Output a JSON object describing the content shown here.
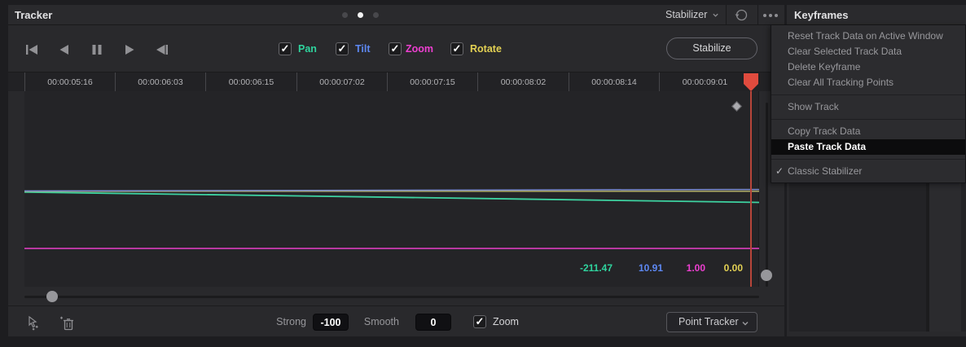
{
  "header": {
    "tracker_title": "Tracker",
    "keyframes_title": "Keyframes",
    "stabilizer_label": "Stabilizer",
    "pager": {
      "dots": 3,
      "active_index": 1
    }
  },
  "icons": {
    "skip_start": "skip-to-start",
    "step_back": "step-back",
    "pause": "pause",
    "play": "play",
    "skip_end": "skip-to-end",
    "reset_history": "circular-reset-arrow",
    "overflow": "ellipsis-menu",
    "stabilizer_chevron": "chevron-down",
    "add_tracker_point": "cursor-with-points",
    "delete_tracker_point": "trash-with-plus"
  },
  "toolbar": {
    "stabilize_button": "Stabilize",
    "checkboxes": [
      {
        "label": "Pan",
        "color": "#2fd49e",
        "checked": true
      },
      {
        "label": "Tilt",
        "color": "#5d88f2",
        "checked": true
      },
      {
        "label": "Zoom",
        "color": "#ee3fd1",
        "checked": true
      },
      {
        "label": "Rotate",
        "color": "#e2d053",
        "checked": true
      }
    ]
  },
  "context_menu": {
    "items": [
      {
        "label": "Reset Track Data on Active Window"
      },
      {
        "label": "Clear Selected Track Data"
      },
      {
        "label": "Delete Keyframe"
      },
      {
        "label": "Clear All Tracking Points"
      },
      {
        "divider": true
      },
      {
        "label": "Show Track"
      },
      {
        "divider": true
      },
      {
        "label": "Copy Track Data"
      },
      {
        "label": "Paste Track Data",
        "highlighted": true
      },
      {
        "divider": true
      },
      {
        "label": "Classic Stabilizer",
        "checked": true
      }
    ]
  },
  "ruler": {
    "timecodes": [
      "00:00:05:16",
      "00:00:06:03",
      "00:00:06:15",
      "00:00:07:02",
      "00:00:07:15",
      "00:00:08:02",
      "00:00:08:14",
      "00:00:09:01"
    ]
  },
  "graph": {
    "series": [
      {
        "name": "Pan",
        "color": "#2fd49e",
        "line_color": "#3ed3a1",
        "current_value": "-211.47",
        "shape": "slight downward slope"
      },
      {
        "name": "Tilt",
        "color": "#5d88f2",
        "line_color": "#7d8ed2",
        "current_value": "10.91",
        "shape": "nearly flat"
      },
      {
        "name": "Zoom",
        "color": "#ee3fd1",
        "line_color": "#ea3fca",
        "current_value": "1.00",
        "shape": "flat"
      },
      {
        "name": "Rotate",
        "color": "#e2d053",
        "line_color": "#a7a463",
        "current_value": "0.00",
        "shape": "flat"
      }
    ],
    "keyframe_marker": "diamond near playhead"
  },
  "bottom_bar": {
    "strong_label": "Strong",
    "strong_value": "-100",
    "smooth_label": "Smooth",
    "smooth_value": "0",
    "zoom_checkbox_label": "Zoom",
    "zoom_checked": true,
    "tracker_mode": "Point Tracker"
  }
}
